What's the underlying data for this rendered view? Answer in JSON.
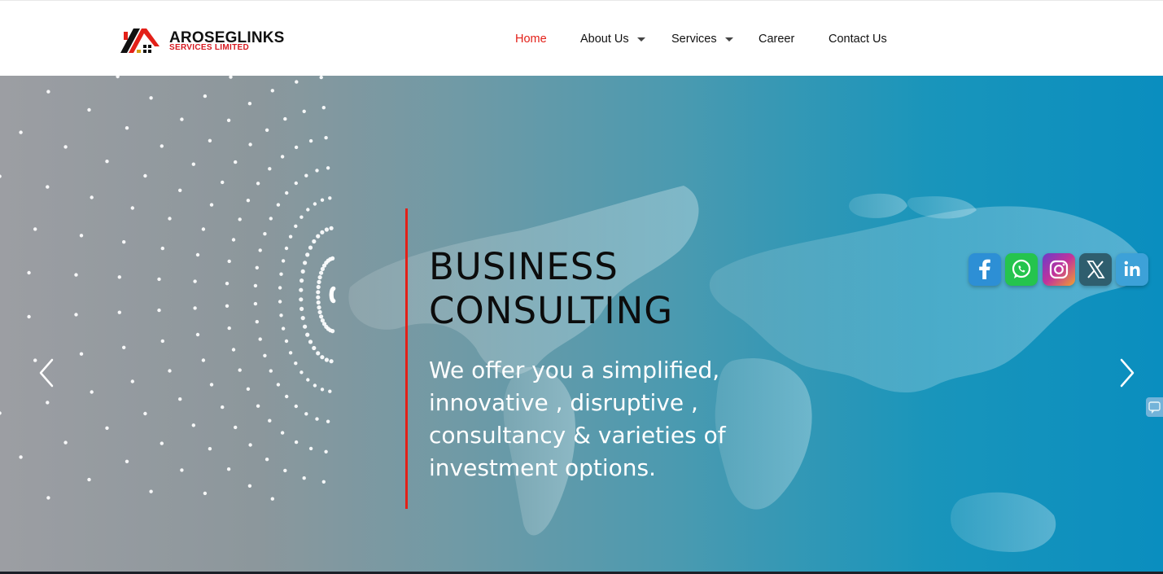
{
  "brand": {
    "name": "AROSEGLINKS",
    "subtitle": "SERVICES LIMITED",
    "accent_color": "#e32018"
  },
  "nav": {
    "items": [
      {
        "label": "Home",
        "active": true,
        "has_dropdown": false
      },
      {
        "label": "About Us",
        "active": false,
        "has_dropdown": true
      },
      {
        "label": "Services",
        "active": false,
        "has_dropdown": true
      },
      {
        "label": "Career",
        "active": false,
        "has_dropdown": false
      },
      {
        "label": "Contact Us",
        "active": false,
        "has_dropdown": false
      }
    ]
  },
  "hero": {
    "title_line1": "BUSINESS",
    "title_line2": "CONSULTING",
    "description": "We offer you a simplified, innovative , disruptive , consultancy & varieties of investment options.",
    "prev_icon": "chevron-left-icon",
    "next_icon": "chevron-right-icon"
  },
  "social": [
    {
      "name": "facebook-icon",
      "color": "#2d8fd5"
    },
    {
      "name": "whatsapp-icon",
      "color": "#25c44d"
    },
    {
      "name": "instagram-icon",
      "color": "#c2339b"
    },
    {
      "name": "x-icon",
      "color": "#2f5e6e"
    },
    {
      "name": "linkedin-icon",
      "color": "#3da1d8"
    }
  ]
}
